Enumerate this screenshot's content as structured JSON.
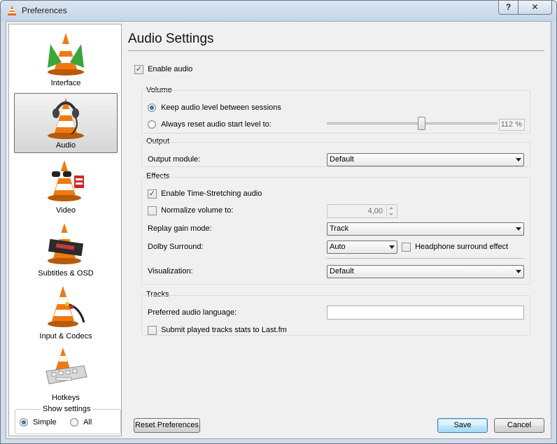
{
  "window": {
    "title": "Preferences",
    "help_label": "?",
    "close_label": "✕"
  },
  "sidebar": {
    "items": [
      {
        "label": "Interface",
        "icon": "vlc-cone-icon"
      },
      {
        "label": "Audio",
        "icon": "vlc-cone-headphones-icon"
      },
      {
        "label": "Video",
        "icon": "vlc-cone-glasses-icon"
      },
      {
        "label": "Subtitles & OSD",
        "icon": "vlc-cone-subtitles-icon"
      },
      {
        "label": "Input & Codecs",
        "icon": "vlc-cone-cable-icon"
      },
      {
        "label": "Hotkeys",
        "icon": "vlc-cone-keyboard-icon"
      }
    ],
    "selected": "Audio",
    "show_settings": {
      "legend": "Show settings",
      "simple": "Simple",
      "all": "All",
      "selected": "Simple"
    }
  },
  "main": {
    "heading": "Audio Settings",
    "enable_audio": {
      "label": "Enable audio",
      "checked": true
    },
    "volume": {
      "title": "Volume",
      "keep_level": {
        "label": "Keep audio level between sessions",
        "selected": true
      },
      "reset_level": {
        "label": "Always reset audio start level to:",
        "selected": false
      },
      "level_percent": 112,
      "level_text": "112 %"
    },
    "output": {
      "title": "Output",
      "module_label": "Output module:",
      "module_value": "Default"
    },
    "effects": {
      "title": "Effects",
      "time_stretch": {
        "label": "Enable Time-Stretching audio",
        "checked": true
      },
      "normalize": {
        "label": "Normalize volume to:",
        "checked": false,
        "value": "4,00"
      },
      "replay_gain_label": "Replay gain mode:",
      "replay_gain_value": "Track",
      "dolby_label": "Dolby Surround:",
      "dolby_value": "Auto",
      "headphone": {
        "label": "Headphone surround effect",
        "checked": false
      },
      "visualization_label": "Visualization:",
      "visualization_value": "Default"
    },
    "tracks": {
      "title": "Tracks",
      "pref_lang_label": "Preferred audio language:",
      "pref_lang_value": "",
      "lastfm": {
        "label": "Submit played tracks stats to Last.fm",
        "checked": false
      }
    }
  },
  "buttons": {
    "reset": "Reset Preferences",
    "save": "Save",
    "cancel": "Cancel"
  },
  "colors": {
    "cone_orange": "#f07a12",
    "window_frame": "#cfdbe8",
    "accent": "#3c7fb1"
  }
}
